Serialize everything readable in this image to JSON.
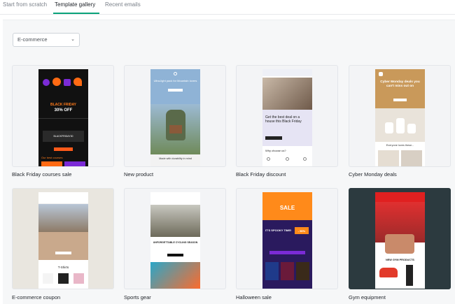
{
  "tabs": [
    {
      "label": "Start from scratch"
    },
    {
      "label": "Template gallery"
    },
    {
      "label": "Recent emails"
    }
  ],
  "accent": "#0aa37a",
  "filter": {
    "selected": "E-commerce"
  },
  "templates": [
    {
      "name": "Black Friday courses sale",
      "preview": {
        "headline": "BLACK FRIDAY",
        "discount": "30% OFF",
        "code": "BLACKFRIDAY30",
        "footer": "Our best courses"
      }
    },
    {
      "name": "New product",
      "preview": {
        "headline": "Ultra-light pack for Mountain lovers",
        "caption": "Made with durability in mind"
      }
    },
    {
      "name": "Black Friday discount",
      "preview": {
        "headline": "Get the best deal on a house this Black Friday",
        "subhead": "Why choose us?"
      }
    },
    {
      "name": "Cyber Monday deals",
      "preview": {
        "headline": "Cyber Monday deals you can't miss out on",
        "subhead": "Everyone loves these..."
      }
    },
    {
      "name": "E-commerce coupon",
      "preview": {
        "subhead": "T-Shirts"
      }
    },
    {
      "name": "Sports gear",
      "preview": {
        "headline": "UNFORGETTABLE CYCLING SEASON"
      }
    },
    {
      "name": "Halloween sale",
      "preview": {
        "headline": "SALE",
        "subhead": "IT'S SPOOKY TIME!",
        "discount": "- 50%"
      }
    },
    {
      "name": "Gym equipment",
      "preview": {
        "subhead": "NEW GYM PRODUCTS"
      }
    }
  ]
}
